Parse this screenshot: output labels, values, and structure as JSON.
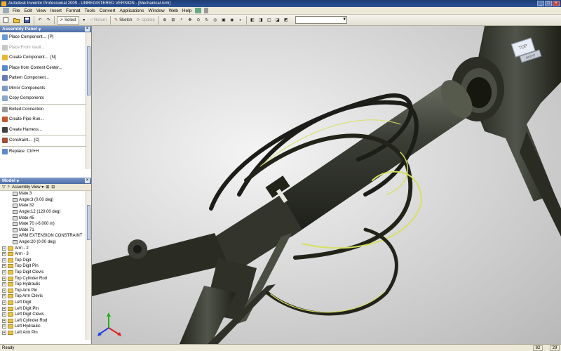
{
  "window": {
    "title": "Autodesk Inventor Professional 2009 - UNREGISTERED VERSION - [Mechanical Arm]"
  },
  "menu": [
    "File",
    "Edit",
    "View",
    "Insert",
    "Format",
    "Tools",
    "Convert",
    "Applications",
    "Window",
    "Web",
    "Help"
  ],
  "toolbar": {
    "select_label": "Select",
    "return_label": "Return",
    "sketch_label": "Sketch",
    "update_label": "Update"
  },
  "assembly_panel": {
    "title": "Assembly Panel",
    "items": [
      {
        "label": "Place Component...",
        "shortcut": "[P]",
        "enabled": true,
        "icon": "place-component-icon"
      },
      {
        "label": "Place From Vault...",
        "shortcut": "",
        "enabled": false,
        "icon": "vault-icon"
      },
      {
        "label": "Create Component...",
        "shortcut": "[N]",
        "enabled": true,
        "icon": "create-component-icon"
      },
      {
        "label": "Place from Content Center...",
        "shortcut": "",
        "enabled": true,
        "icon": "content-center-icon"
      },
      {
        "label": "Pattern Component...",
        "shortcut": "",
        "enabled": true,
        "icon": "pattern-icon"
      },
      {
        "label": "Mirror Components",
        "shortcut": "",
        "enabled": true,
        "icon": "mirror-icon"
      },
      {
        "label": "Copy Components",
        "shortcut": "",
        "enabled": true,
        "icon": "copy-icon"
      },
      {
        "label": "Bolted Connection",
        "shortcut": "",
        "enabled": true,
        "icon": "bolt-icon"
      },
      {
        "label": "Create Pipe Run...",
        "shortcut": "",
        "enabled": true,
        "icon": "pipe-icon"
      },
      {
        "label": "Create Harness...",
        "shortcut": "",
        "enabled": true,
        "icon": "harness-icon"
      },
      {
        "label": "Constraint...",
        "shortcut": "[C]",
        "enabled": true,
        "icon": "constraint-icon"
      },
      {
        "label": "Replace",
        "shortcut": "Ctrl+H",
        "enabled": true,
        "icon": "replace-icon"
      }
    ]
  },
  "model_panel": {
    "title": "Model",
    "view_label": "Assembly View",
    "tree": [
      {
        "label": "Mate:3",
        "kind": "constraint",
        "indent": 2
      },
      {
        "label": "Angle:3 (0.00 deg)",
        "kind": "constraint",
        "indent": 2
      },
      {
        "label": "Mate:32",
        "kind": "constraint",
        "indent": 2
      },
      {
        "label": "Angle:12 (120.00 deg)",
        "kind": "constraint",
        "indent": 2
      },
      {
        "label": "Mate:45",
        "kind": "constraint",
        "indent": 2
      },
      {
        "label": "Mate:70 (-6.000 in)",
        "kind": "constraint",
        "indent": 2
      },
      {
        "label": "Mate:71",
        "kind": "constraint",
        "indent": 2
      },
      {
        "label": "ARM EXTENSION CONSTRAINT",
        "kind": "constraint",
        "indent": 2
      },
      {
        "label": "Angle:20 (0.00 deg)",
        "kind": "constraint",
        "indent": 2
      },
      {
        "label": "Arm - 2",
        "kind": "part",
        "indent": 0
      },
      {
        "label": "Arm - 3",
        "kind": "part",
        "indent": 0
      },
      {
        "label": "Top Digit",
        "kind": "part",
        "indent": 0
      },
      {
        "label": "Top Digit Pin",
        "kind": "part",
        "indent": 0
      },
      {
        "label": "Top Digit Clevis",
        "kind": "part",
        "indent": 0
      },
      {
        "label": "Top Cylinder Rod",
        "kind": "part",
        "indent": 0
      },
      {
        "label": "Top Hydraulic",
        "kind": "part",
        "indent": 0
      },
      {
        "label": "Top Arm Pin",
        "kind": "part",
        "indent": 0
      },
      {
        "label": "Top Arm Clevis",
        "kind": "part",
        "indent": 0
      },
      {
        "label": "Left Digit",
        "kind": "part",
        "indent": 0
      },
      {
        "label": "Left Digit Pin",
        "kind": "part",
        "indent": 0
      },
      {
        "label": "Left Digit Clevis",
        "kind": "part",
        "indent": 0
      },
      {
        "label": "Left Cylinder Rod",
        "kind": "part",
        "indent": 0
      },
      {
        "label": "Left Hydraulic",
        "kind": "part",
        "indent": 0
      },
      {
        "label": "Left Arm Pin",
        "kind": "part",
        "indent": 0
      }
    ]
  },
  "viewcube": {
    "top_label": "TOP",
    "right_label": "RIGHT"
  },
  "status": {
    "text": "Ready",
    "count_a": "82",
    "count_b": "29"
  },
  "colors": {
    "title_bar": "#2a5298",
    "panel_header": "#5c7cb4",
    "harness_highlight": "#d8e060",
    "axis_x": "#e02020",
    "axis_y": "#20b020",
    "axis_z": "#2040e0"
  }
}
